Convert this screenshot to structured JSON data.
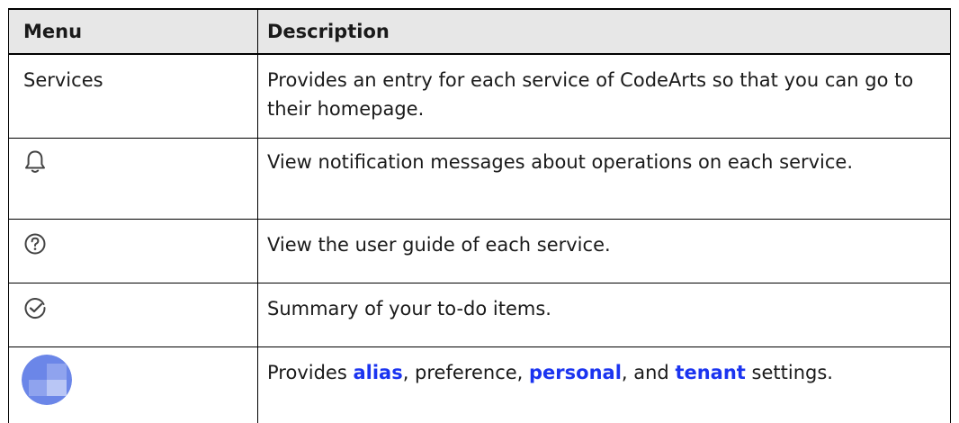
{
  "table": {
    "headers": {
      "menu": "Menu",
      "description": "Description"
    },
    "rows": {
      "services": {
        "menu": "Services",
        "description": "Provides an entry for each service of CodeArts so that you can go to their homepage."
      },
      "notifications": {
        "icon": "bell-icon",
        "description": "View notification messages about operations on each service."
      },
      "help": {
        "icon": "help-circle-icon",
        "description": "View the user guide of each service."
      },
      "todo": {
        "icon": "check-circle-icon",
        "description": "Summary of your to-do items."
      },
      "account": {
        "icon": "avatar-icon",
        "desc_prefix": "Provides ",
        "link_alias": "alias",
        "desc_mid1": ", preference, ",
        "link_personal": "personal",
        "desc_mid2": ", and ",
        "link_tenant": "tenant",
        "desc_suffix": " settings."
      }
    }
  },
  "colors": {
    "header_bg": "#e7e7e7",
    "link": "#1b34f0",
    "avatar_primary": "#6b86e8",
    "avatar_light": "#b9c6f5"
  }
}
